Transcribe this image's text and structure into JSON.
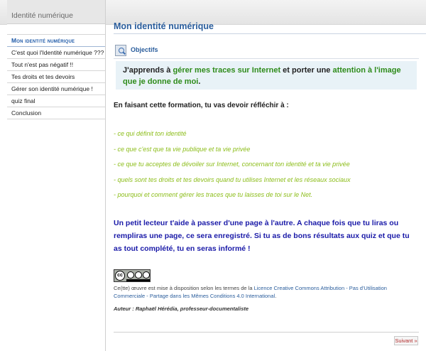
{
  "sidebar": {
    "header": "Identité numérique",
    "items": [
      {
        "label": "Mon identité numérique"
      },
      {
        "label": "C'est quoi l'Identité numérique ???"
      },
      {
        "label": "Tout n'est pas négatif !!"
      },
      {
        "label": "Tes droits et tes devoirs"
      },
      {
        "label": "Gérer son identité numérique !"
      },
      {
        "label": "quiz final"
      },
      {
        "label": "Conclusion"
      }
    ]
  },
  "main": {
    "title": "Mon identité numérique",
    "objectifs_label": "Objectifs",
    "objectif": {
      "part1": "J'apprends à ",
      "part2": "gérer mes traces sur Internet",
      "part3": " et porter une ",
      "part4": "attention à l'image que je donne de moi",
      "part5": "."
    },
    "intro": "En faisant cette formation, tu vas devoir réfléchir à :",
    "bullets": [
      "- ce qui définit ton identité",
      "- ce que c'est que ta vie publique et ta vie privée",
      "- ce que tu acceptes de dévoiler sur Internet, concernant ton identité et ta vie privée",
      "- quels sont tes droits et tes devoirs quand tu utilises Internet et les réseaux sociaux",
      "- pourquoi et comment gérer les traces que tu laisses de toi sur le Net."
    ],
    "lecteur": "Un petit lecteur t'aide à passer d'une page à l'autre. A chaque fois que tu liras ou rempliras une page, ce sera enregistré. Si tu as de bons résultats aux quiz et que tu as tout complété, tu en seras informé !",
    "license": {
      "badge": "cc",
      "prefix": "Ce(tte) œuvre est mise à disposition selon les termes de la ",
      "link": "Licence Creative Commons Attribution - Pas d'Utilisation Commerciale - Partage dans les Mêmes Conditions 4.0 International",
      "suffix": "."
    },
    "author": "Auteur : Raphaël Hérédia, professeur-documentaliste",
    "next_label": "Suivant »"
  },
  "colors": {
    "title_blue": "#2a5d9c",
    "green_text": "#2e8b1a",
    "bullet_green": "#8cbd1a",
    "lecteur_blue": "#1a1aa8",
    "objectif_bg": "#e8f2f7",
    "next_red": "#b22a2a"
  }
}
